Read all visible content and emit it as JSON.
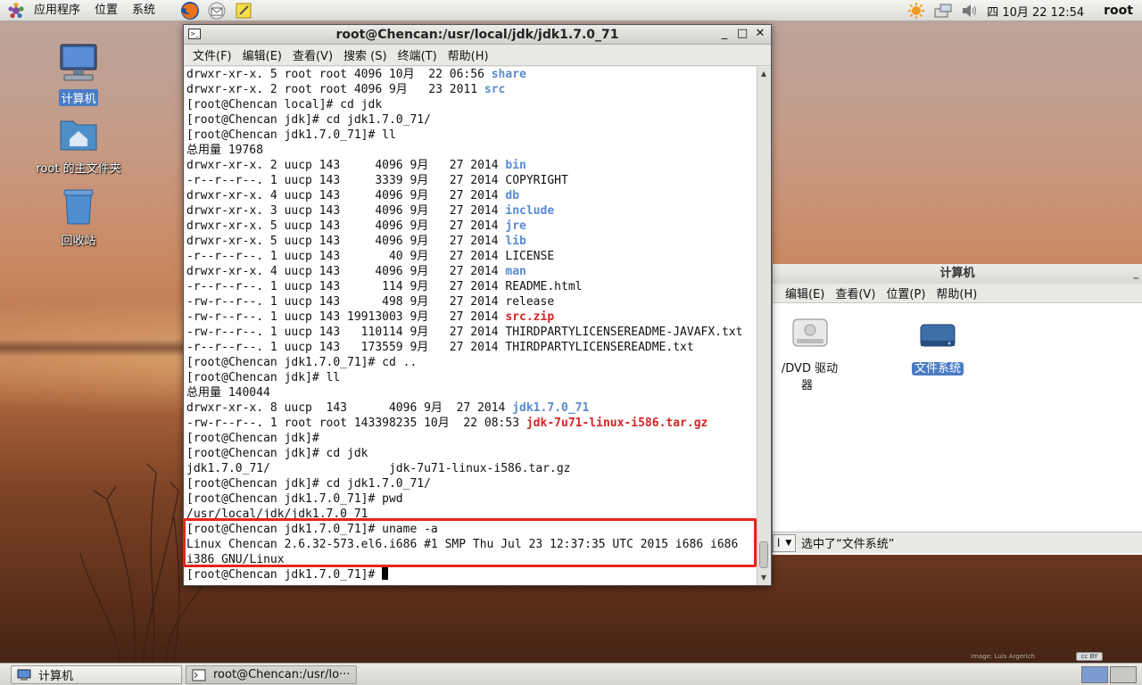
{
  "top_panel": {
    "menus": [
      "应用程序",
      "位置",
      "系统"
    ],
    "launchers": [
      "firefox-icon",
      "mail-icon",
      "notes-icon"
    ],
    "clock": "四 10月 22 12:54",
    "user": "root",
    "tray_icons": [
      "weather-icon",
      "network-icon",
      "volume-icon"
    ]
  },
  "desktop": {
    "icons": [
      {
        "label": "计算机",
        "icon": "computer-icon",
        "selected": true
      },
      {
        "label": "root 的主文件夹",
        "icon": "home-folder-icon",
        "selected": false
      },
      {
        "label": "回收站",
        "icon": "trash-icon",
        "selected": false
      }
    ],
    "watermark": "Image: Luis Argerich"
  },
  "terminal": {
    "title": "root@Chencan:/usr/local/jdk/jdk1.7.0_71",
    "controls": [
      "_",
      "□",
      "✕"
    ],
    "menus": [
      "文件(F)",
      "编辑(E)",
      "查看(V)",
      "搜索 (S)",
      "终端(T)",
      "帮助(H)"
    ],
    "lines": [
      [
        {
          "t": "drwxr-xr-x. 5 root root 4096 10月  22 06:56 "
        },
        {
          "t": "share",
          "c": "blue"
        }
      ],
      [
        {
          "t": "drwxr-xr-x. 2 root root 4096 9月   23 2011 "
        },
        {
          "t": "src",
          "c": "blue"
        }
      ],
      [
        {
          "t": "[root@Chencan local]# cd jdk"
        }
      ],
      [
        {
          "t": "[root@Chencan jdk]# cd jdk1.7.0_71/"
        }
      ],
      [
        {
          "t": "[root@Chencan jdk1.7.0_71]# ll"
        }
      ],
      [
        {
          "t": "总用量 19768"
        }
      ],
      [
        {
          "t": "drwxr-xr-x. 2 uucp 143     4096 9月   27 2014 "
        },
        {
          "t": "bin",
          "c": "blue"
        }
      ],
      [
        {
          "t": "-r--r--r--. 1 uucp 143     3339 9月   27 2014 COPYRIGHT"
        }
      ],
      [
        {
          "t": "drwxr-xr-x. 4 uucp 143     4096 9月   27 2014 "
        },
        {
          "t": "db",
          "c": "blue"
        }
      ],
      [
        {
          "t": "drwxr-xr-x. 3 uucp 143     4096 9月   27 2014 "
        },
        {
          "t": "include",
          "c": "blue"
        }
      ],
      [
        {
          "t": "drwxr-xr-x. 5 uucp 143     4096 9月   27 2014 "
        },
        {
          "t": "jre",
          "c": "blue"
        }
      ],
      [
        {
          "t": "drwxr-xr-x. 5 uucp 143     4096 9月   27 2014 "
        },
        {
          "t": "lib",
          "c": "blue"
        }
      ],
      [
        {
          "t": "-r--r--r--. 1 uucp 143       40 9月   27 2014 LICENSE"
        }
      ],
      [
        {
          "t": "drwxr-xr-x. 4 uucp 143     4096 9月   27 2014 "
        },
        {
          "t": "man",
          "c": "blue"
        }
      ],
      [
        {
          "t": "-r--r--r--. 1 uucp 143      114 9月   27 2014 README.html"
        }
      ],
      [
        {
          "t": "-rw-r--r--. 1 uucp 143      498 9月   27 2014 release"
        }
      ],
      [
        {
          "t": "-rw-r--r--. 1 uucp 143 19913003 9月   27 2014 "
        },
        {
          "t": "src.zip",
          "c": "red"
        }
      ],
      [
        {
          "t": "-rw-r--r--. 1 uucp 143   110114 9月   27 2014 THIRDPARTYLICENSEREADME-JAVAFX.txt"
        }
      ],
      [
        {
          "t": "-r--r--r--. 1 uucp 143   173559 9月   27 2014 THIRDPARTYLICENSEREADME.txt"
        }
      ],
      [
        {
          "t": "[root@Chencan jdk1.7.0_71]# cd .."
        }
      ],
      [
        {
          "t": "[root@Chencan jdk]# ll"
        }
      ],
      [
        {
          "t": "总用量 140044"
        }
      ],
      [
        {
          "t": "drwxr-xr-x. 8 uucp  143      4096 9月  27 2014 "
        },
        {
          "t": "jdk1.7.0_71",
          "c": "blue"
        }
      ],
      [
        {
          "t": "-rw-r--r--. 1 root root 143398235 10月  22 08:53 "
        },
        {
          "t": "jdk-7u71-linux-i586.tar.gz",
          "c": "red"
        }
      ],
      [
        {
          "t": "[root@Chencan jdk]#"
        }
      ],
      [
        {
          "t": "[root@Chencan jdk]# cd jdk"
        }
      ],
      [
        {
          "t": "jdk1.7.0_71/                 jdk-7u71-linux-i586.tar.gz"
        }
      ],
      [
        {
          "t": "[root@Chencan jdk]# cd jdk1.7.0_71/"
        }
      ],
      [
        {
          "t": "[root@Chencan jdk1.7.0_71]# pwd"
        }
      ],
      [
        {
          "t": "/usr/local/jdk/jdk1.7.0_71"
        }
      ],
      [
        {
          "t": "[root@Chencan jdk1.7.0_71]# uname -a"
        }
      ],
      [
        {
          "t": "Linux Chencan 2.6.32-573.el6.i686 #1 SMP Thu Jul 23 12:37:35 UTC 2015 i686 i686"
        }
      ],
      [
        {
          "t": "i386 GNU/Linux"
        }
      ],
      [
        {
          "t": "[root@Chencan jdk1.7.0_71]# "
        },
        {
          "cursor": true
        }
      ]
    ]
  },
  "file_manager": {
    "title": "计算机",
    "menus": [
      "编辑(E)",
      "查看(V)",
      "位置(P)",
      "帮助(H)"
    ],
    "items": [
      {
        "label": "/DVD 驱动器",
        "icon": "optical-drive-icon",
        "selected": false
      },
      {
        "label": "文件系统",
        "icon": "filesystem-icon",
        "selected": true
      }
    ],
    "status": "选中了“文件系统”",
    "combo_value": "l"
  },
  "bottom_panel": {
    "tasks": [
      {
        "label": "计算机",
        "icon": "computer-icon",
        "active": false
      },
      {
        "label": "root@Chencan:/usr/lo···",
        "icon": "terminal-icon",
        "active": true
      }
    ]
  },
  "colors": {
    "ls_directory": "#5a8ad0",
    "ls_archive": "#d42424",
    "highlight_box": "#e8231c",
    "selection": "#4a7cc4"
  }
}
